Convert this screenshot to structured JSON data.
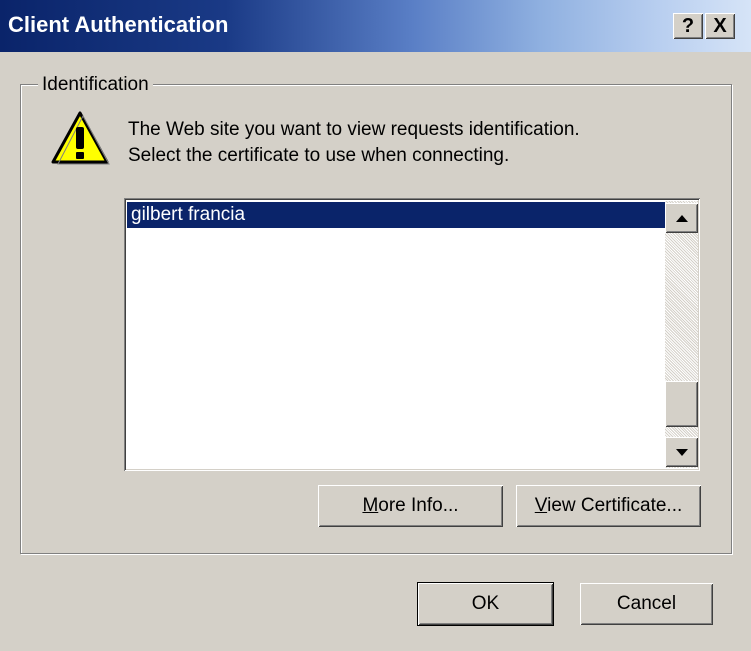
{
  "window": {
    "title": "Client Authentication",
    "help_label": "?",
    "close_label": "X"
  },
  "identification": {
    "group_label": "Identification",
    "message_line1": "The Web site you want to view requests identification.",
    "message_line2": "Select the certificate to use when connecting.",
    "icon": "warning-icon"
  },
  "certificates": {
    "items": [
      "gilbert francia"
    ],
    "selected": "gilbert francia"
  },
  "buttons": {
    "more_info": {
      "mnemonic": "M",
      "rest": "ore Info..."
    },
    "view_certificate": {
      "mnemonic": "V",
      "rest": "iew Certificate..."
    },
    "ok": "OK",
    "cancel": "Cancel"
  },
  "colors": {
    "title_start": "#0a246a",
    "selection": "#0a246a",
    "face": "#d4d0c8",
    "warning_yellow": "#ffff00"
  }
}
